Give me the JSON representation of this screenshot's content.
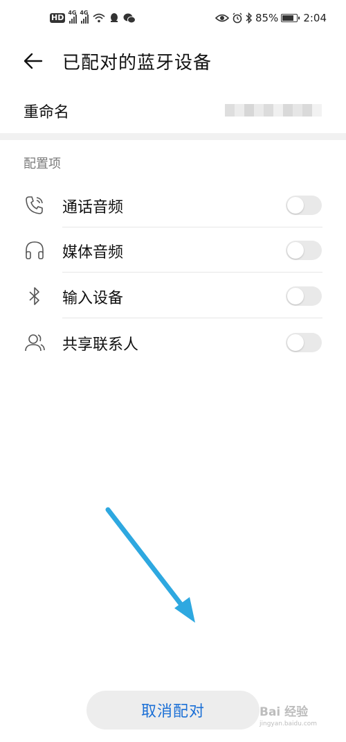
{
  "status_bar": {
    "hd": "HD",
    "net1": "4G",
    "net2": "4G",
    "battery_text": "85%",
    "battery_level": 0.85,
    "time": "2:04",
    "icons_left": [
      "hd-icon",
      "signal-icon",
      "signal-icon",
      "wifi-icon",
      "qq-icon",
      "wechat-icon"
    ],
    "icons_right": [
      "eye-icon",
      "alarm-icon",
      "bluetooth-icon",
      "battery-icon"
    ]
  },
  "header": {
    "title": "已配对的蓝牙设备"
  },
  "rename": {
    "label": "重命名"
  },
  "config": {
    "section_title": "配置项",
    "items": [
      {
        "label": "通话音频",
        "icon": "phone-icon",
        "enabled": false
      },
      {
        "label": "媒体音频",
        "icon": "headphones-icon",
        "enabled": false
      },
      {
        "label": "输入设备",
        "icon": "bluetooth-icon",
        "enabled": false
      },
      {
        "label": "共享联系人",
        "icon": "contacts-icon",
        "enabled": false
      }
    ]
  },
  "actions": {
    "unpair_label": "取消配对"
  },
  "annotation": {
    "arrow_color": "#2ea8e0"
  },
  "watermark": {
    "main": "Bai 经验",
    "sub": "jingyan.baidu.com"
  },
  "colors": {
    "accent": "#1a6fd6",
    "toggle_off": "#e9e9e9",
    "section_bg": "#f1f1f1"
  }
}
